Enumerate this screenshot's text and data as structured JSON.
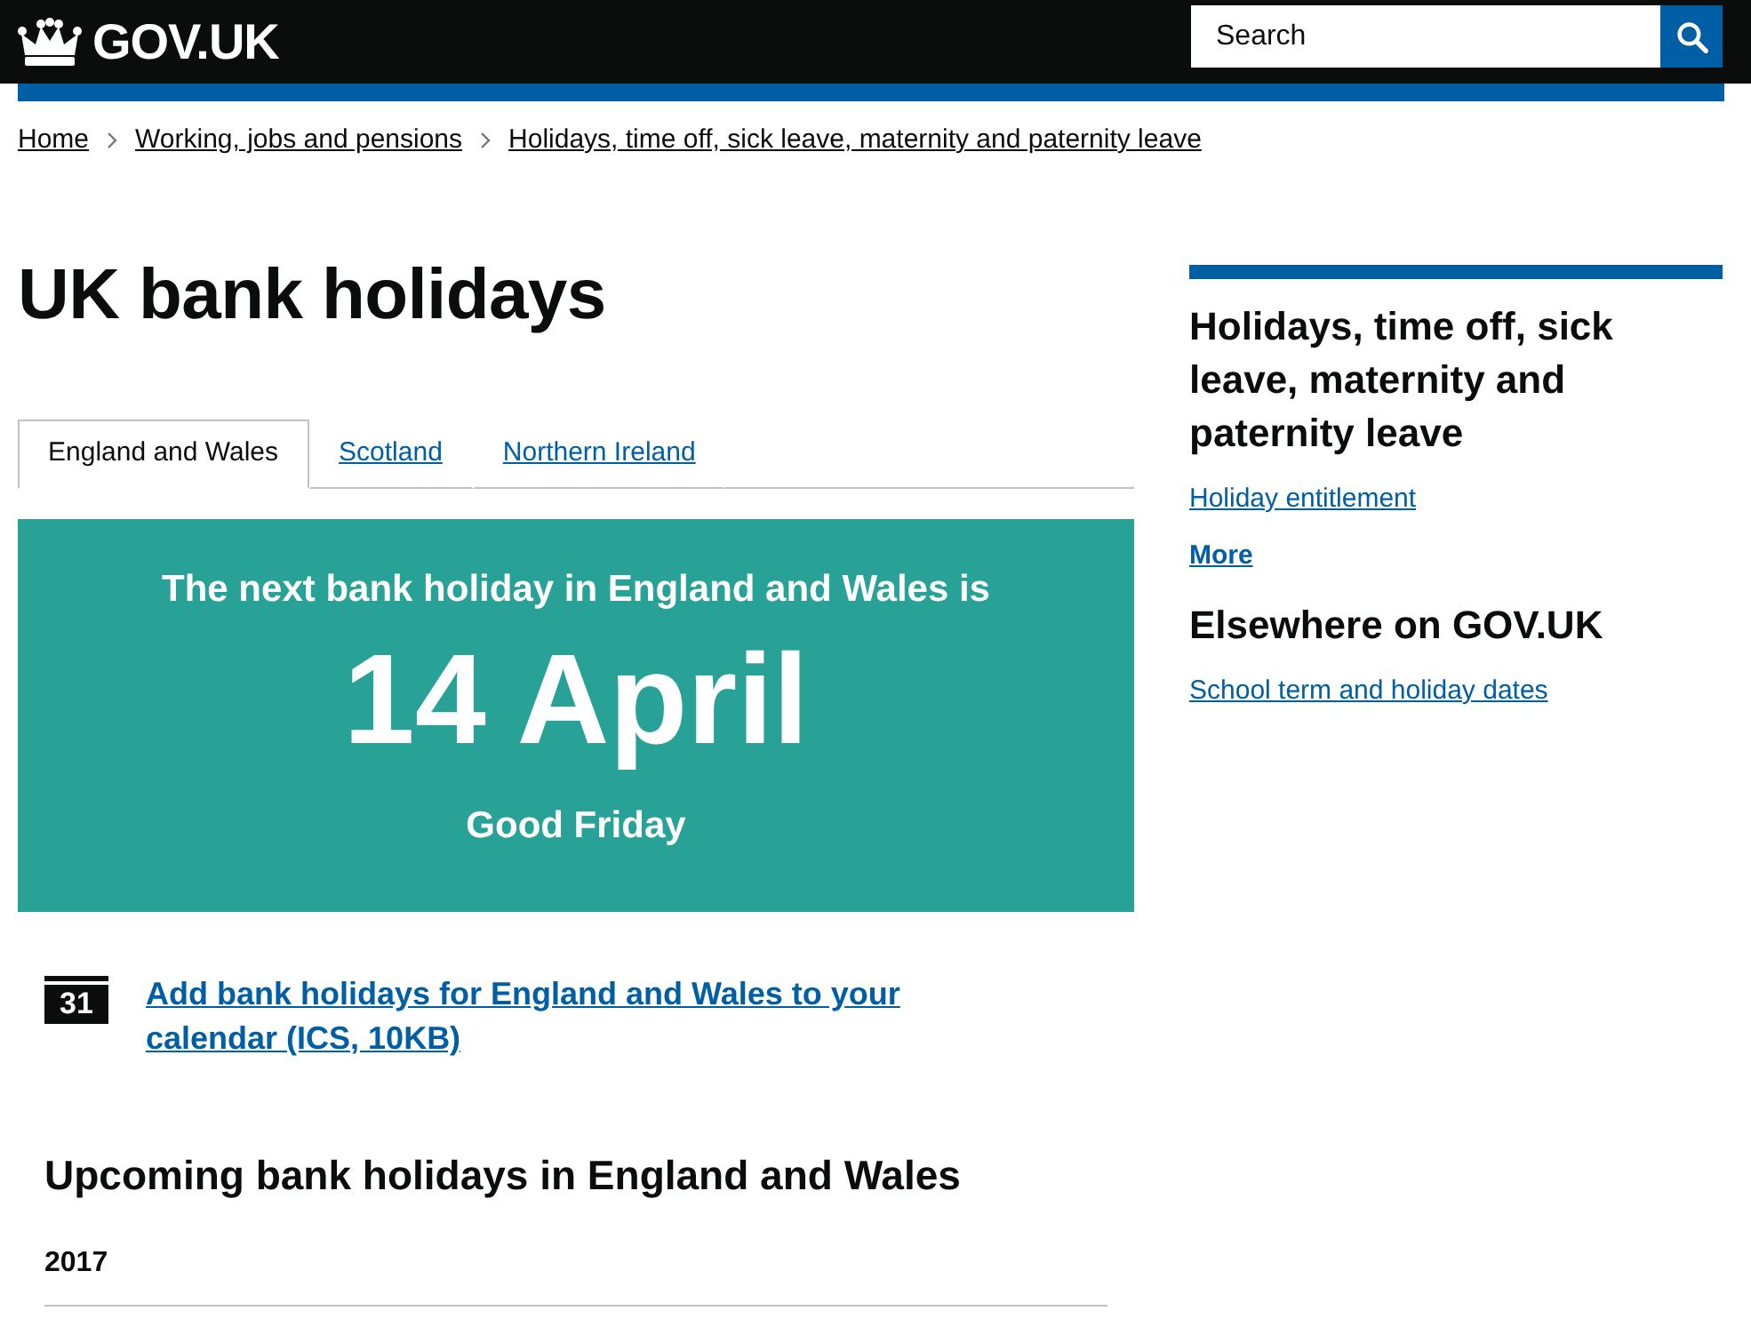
{
  "header": {
    "logo": "GOV.UK",
    "search": {
      "placeholder": "Search"
    }
  },
  "breadcrumbs": [
    {
      "label": "Home"
    },
    {
      "label": "Working, jobs and pensions"
    },
    {
      "label": "Holidays, time off, sick leave, maternity and paternity leave"
    }
  ],
  "title": "UK bank holidays",
  "tabs": [
    {
      "label": "England and Wales",
      "selected": true
    },
    {
      "label": "Scotland",
      "selected": false
    },
    {
      "label": "Northern Ireland",
      "selected": false
    }
  ],
  "next_holiday": {
    "intro": "The next bank holiday in England and Wales is",
    "date": "14 April",
    "name": "Good Friday"
  },
  "calendar_link": {
    "icon_text": "31",
    "label": "Add bank holidays for England and Wales to your calendar (ICS, 10KB)"
  },
  "upcoming": {
    "heading": "Upcoming bank holidays in England and Wales",
    "year": "2017"
  },
  "sidebar": {
    "sections": [
      {
        "heading": "Holidays, time off, sick leave, maternity and paternity leave",
        "links": [
          {
            "label": "Holiday entitlement"
          }
        ],
        "more": "More"
      },
      {
        "heading": "Elsewhere on GOV.UK",
        "links": [
          {
            "label": "School term and holiday dates"
          }
        ]
      }
    ]
  }
}
